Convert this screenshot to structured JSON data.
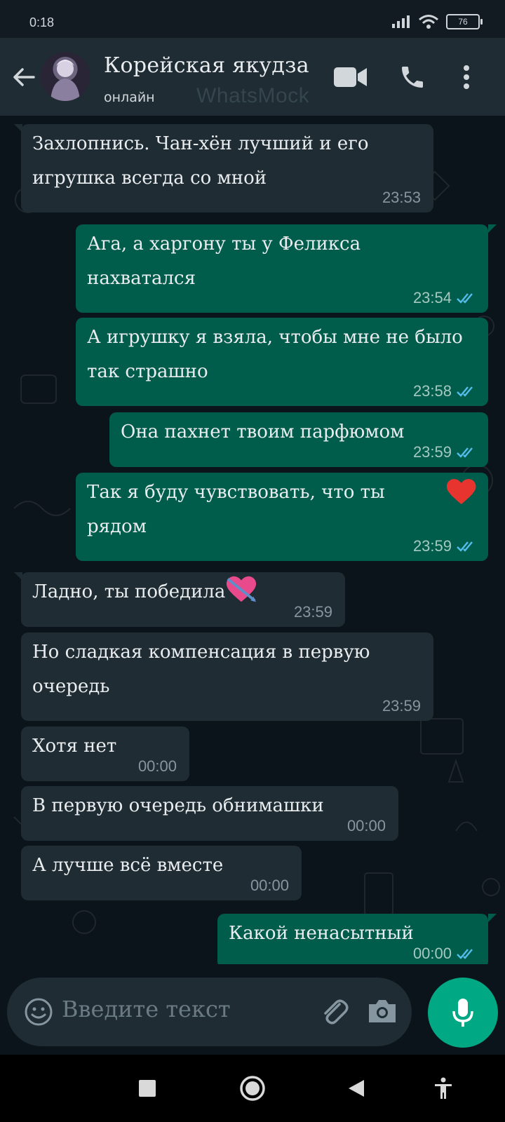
{
  "status_bar": {
    "time": "0:18",
    "battery": "76"
  },
  "header": {
    "contact_name": "Корейская якудза",
    "status": "онлайн",
    "watermark": "WhatsMock"
  },
  "messages": [
    {
      "dir": "in",
      "lines": [
        "Захлопнись. Чан-хён лучший и его",
        "игрушка всегда со мной"
      ],
      "time": "23:53"
    },
    {
      "dir": "out",
      "lines": [
        "Ага, а харгону ты у Феликса",
        "нахватался"
      ],
      "time": "23:54",
      "read": true
    },
    {
      "dir": "out",
      "lines": [
        "А игрушку я взяла, чтобы мне не было",
        "так страшно"
      ],
      "time": "23:58",
      "read": true
    },
    {
      "dir": "out",
      "lines": [
        "Она пахнет твоим парфюмом"
      ],
      "time": "23:59",
      "read": true
    },
    {
      "dir": "out",
      "lines": [
        "Так я буду чувствовать, что ты рядом"
      ],
      "emoji": "red-heart",
      "time": "23:59",
      "read": true
    },
    {
      "dir": "in",
      "lines": [
        "Ладно, ты победила"
      ],
      "emoji": "heart-with-arrow",
      "time": "23:59"
    },
    {
      "dir": "in",
      "lines": [
        "Но сладкая компенсация в первую",
        "очередь"
      ],
      "time": "23:59"
    },
    {
      "dir": "in",
      "lines": [
        "Хотя нет"
      ],
      "time": "00:00"
    },
    {
      "dir": "in",
      "lines": [
        "В первую очередь обнимашки"
      ],
      "time": "00:00"
    },
    {
      "dir": "in",
      "lines": [
        "А лучше всё вместе"
      ],
      "time": "00:00"
    },
    {
      "dir": "out",
      "lines": [
        "Какой ненасытный"
      ],
      "time": "00:00",
      "read": true
    }
  ],
  "input": {
    "placeholder": "Введите текст"
  },
  "colors": {
    "incoming_bubble": "#1f2c33",
    "outgoing_bubble": "#005c4b",
    "read_tick": "#53bdeb",
    "mic_button": "#00a884",
    "chat_background": "#0b141a"
  },
  "icons": {
    "header": [
      "arrow-left-icon",
      "video-call-icon",
      "phone-icon",
      "more-vert-icon"
    ],
    "input": [
      "emoji-icon",
      "attach-icon",
      "camera-icon",
      "mic-icon"
    ],
    "nav": [
      "recents-icon",
      "home-icon",
      "back-icon",
      "accessibility-icon"
    ]
  }
}
